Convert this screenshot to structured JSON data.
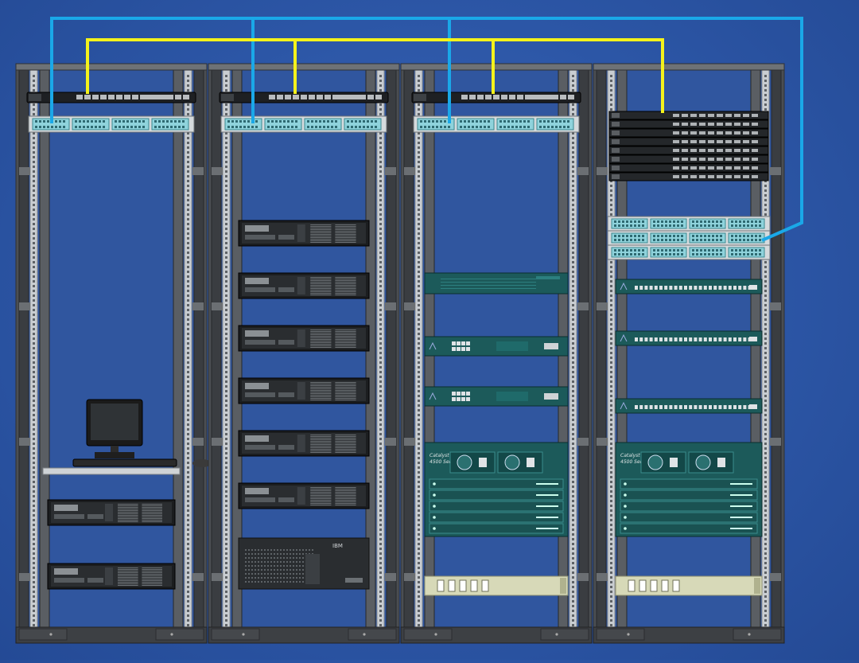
{
  "diagram": {
    "racks": [
      {
        "patch_panel": {
          "ports_groups": 4
        },
        "switch": {
          "style": "gray"
        },
        "equipment": [
          {
            "type": "monitor-shelf"
          },
          {
            "type": "server-2u"
          },
          {
            "type": "server-2u"
          }
        ]
      },
      {
        "patch_panel": {
          "ports_groups": 4
        },
        "switch": {
          "style": "gray"
        },
        "equipment": [
          {
            "type": "server-2u"
          },
          {
            "type": "server-2u"
          },
          {
            "type": "server-2u"
          },
          {
            "type": "server-2u"
          },
          {
            "type": "server-2u"
          },
          {
            "type": "server-2u"
          },
          {
            "type": "storage-unit",
            "brand": "IBM"
          }
        ]
      },
      {
        "patch_panel": {
          "ports_groups": 4
        },
        "switch": {
          "style": "gray"
        },
        "equipment": [
          {
            "type": "firewall-1u"
          },
          {
            "type": "router-1u"
          },
          {
            "type": "router-1u"
          },
          {
            "type": "chassis-switch",
            "label_1": "Catalyst",
            "label_2": "4500 Series"
          },
          {
            "type": "power-strip"
          }
        ]
      },
      {
        "patch_panel": {
          "ports_groups": 12
        },
        "switch_stack": {
          "count": 8
        },
        "equipment": [
          {
            "type": "switch-1u"
          },
          {
            "type": "switch-1u"
          },
          {
            "type": "switch-1u"
          },
          {
            "type": "chassis-switch",
            "label_1": "Catalyst",
            "label_2": "4500 Series"
          },
          {
            "type": "power-strip"
          }
        ]
      }
    ],
    "cables": [
      {
        "name": "blue-cable",
        "color": "#1aa8e8"
      },
      {
        "name": "yellow-cable",
        "color": "#f4f21c"
      }
    ],
    "colors": {
      "background": "#2c56a6",
      "rack_frame": "#4b4e52",
      "rack_rail": "#c9cdd1",
      "patch_panel": "#8fd3dc",
      "equipment_dark": "#1c5a5a",
      "server_face": "#2a2d30"
    }
  }
}
